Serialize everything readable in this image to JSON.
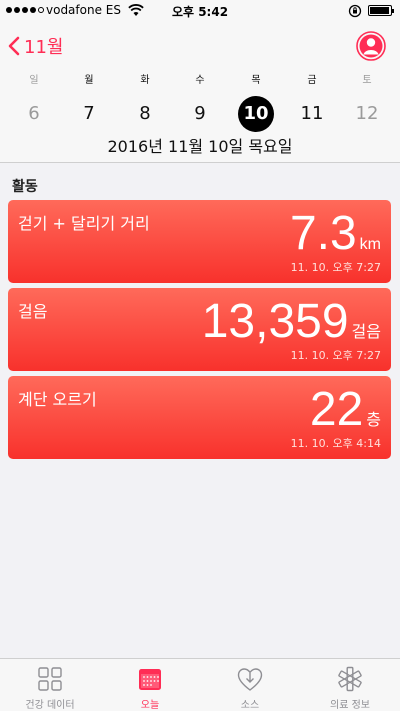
{
  "status_bar": {
    "carrier": "vodafone ES",
    "time": "오후 5:42",
    "signal_bars": 4
  },
  "nav": {
    "back_label": "11월"
  },
  "week": {
    "days": [
      {
        "weekday": "일",
        "date": "6",
        "dim": true
      },
      {
        "weekday": "월",
        "date": "7",
        "dim": false
      },
      {
        "weekday": "화",
        "date": "8",
        "dim": false
      },
      {
        "weekday": "수",
        "date": "9",
        "dim": false
      },
      {
        "weekday": "목",
        "date": "10",
        "dim": false,
        "selected": true
      },
      {
        "weekday": "금",
        "date": "11",
        "dim": false
      },
      {
        "weekday": "토",
        "date": "12",
        "dim": true
      }
    ],
    "full_date": "2016년 11월 10일 목요일"
  },
  "activity": {
    "title": "활동",
    "cards": [
      {
        "label": "걷기 + 달리기 거리",
        "value": "7.3",
        "unit": "km",
        "time": "11. 10. 오후 7:27"
      },
      {
        "label": "걸음",
        "value": "13,359",
        "unit": "걸음",
        "time": "11. 10. 오후 7:27"
      },
      {
        "label": "계단 오르기",
        "value": "22",
        "unit": "층",
        "time": "11. 10. 오후 4:14"
      }
    ]
  },
  "tabs": [
    {
      "label": "건강 데이터",
      "icon": "grid-icon"
    },
    {
      "label": "오늘",
      "icon": "calendar-icon",
      "active": true
    },
    {
      "label": "소스",
      "icon": "heart-download-icon"
    },
    {
      "label": "의료 정보",
      "icon": "medical-star-icon"
    }
  ],
  "colors": {
    "accent": "#ff2d55",
    "card_top": "#ff6a5a",
    "card_bottom": "#f8312c"
  }
}
